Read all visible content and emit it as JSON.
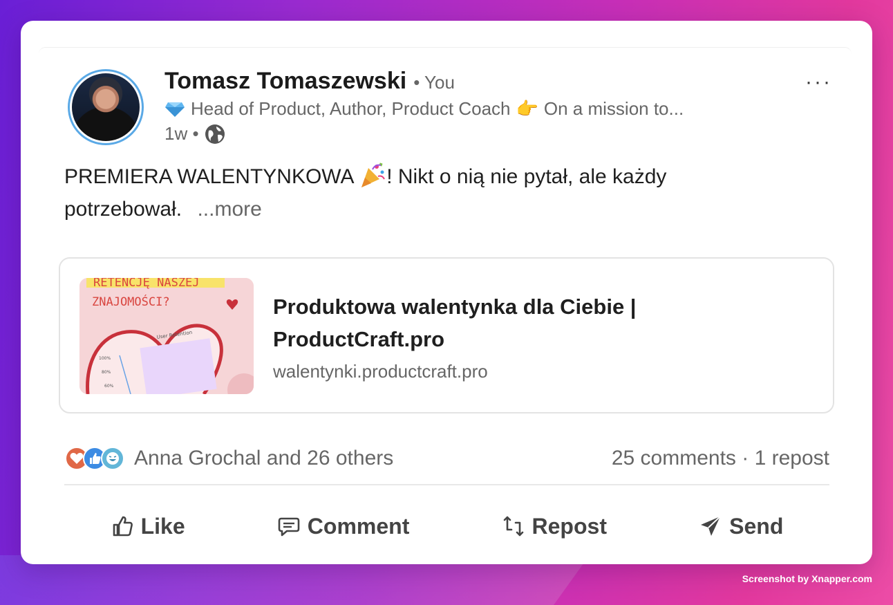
{
  "post": {
    "author_name": "Tomasz Tomaszewski",
    "author_relation": "• You",
    "headline_prefix": "Head of Product, Author, Product Coach",
    "headline_suffix": "On a mission to...",
    "time": "1w •",
    "body_part1": "PREMIERA WALENTYNKOWA",
    "body_part2": "! Nikt o nią nie pytał, ale każdy potrzebował.",
    "see_more": "...more",
    "more_menu": "···"
  },
  "link_preview": {
    "title": "Produktowa walentynka dla Ciebie | ProductCraft.pro",
    "domain": "walentynki.productcraft.pro",
    "thumb_line1": "RETENCJĘ NASZEJ",
    "thumb_line2": "ZNAJOMOŚCI?",
    "thumb_chart_title": "User Retention",
    "thumb_axis": [
      "100%",
      "80%",
      "60%"
    ]
  },
  "social": {
    "reactions_text": "Anna Grochal and 26 others",
    "comments": "25 comments",
    "separator": " · ",
    "reposts": "1 repost",
    "reaction_icons": [
      "love-icon",
      "like-icon",
      "funny-icon"
    ]
  },
  "actions": [
    {
      "label": "Like",
      "icon": "like-icon"
    },
    {
      "label": "Comment",
      "icon": "comment-icon"
    },
    {
      "label": "Repost",
      "icon": "repost-icon"
    },
    {
      "label": "Send",
      "icon": "send-icon"
    }
  ],
  "watermark": "Screenshot by Xnapper.com",
  "colors": {
    "avatar_ring": "#5aa9e6",
    "text_primary": "#1f1f1f",
    "text_secondary": "#666666",
    "card_border": "#e3e3e3"
  }
}
